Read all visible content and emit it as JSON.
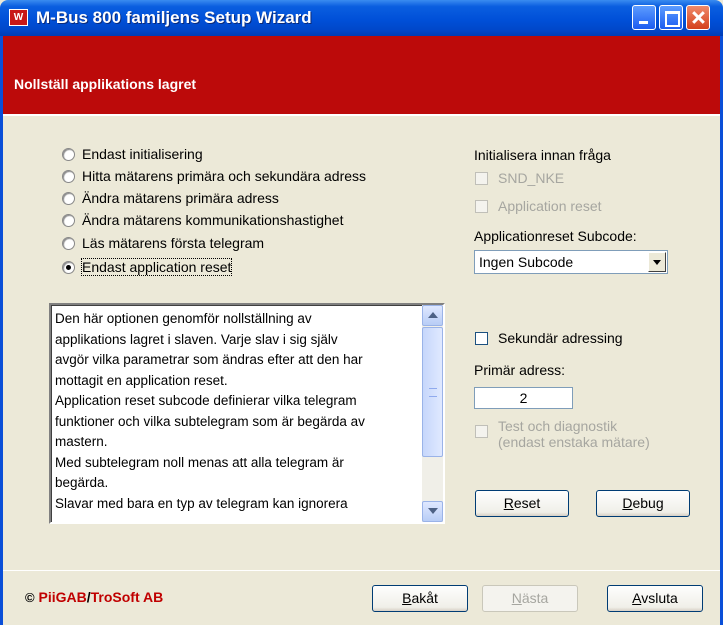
{
  "window": {
    "title": "M-Bus 800 familjens Setup Wizard",
    "app_icon_text": "W"
  },
  "header": {
    "title": "Nollställ applikations lagret"
  },
  "options": [
    {
      "label": "Endast initialisering",
      "checked": false
    },
    {
      "label": "Hitta mätarens primära och sekundära adress",
      "checked": false
    },
    {
      "label": "Ändra mätarens primära adress",
      "checked": false
    },
    {
      "label": "Ändra mätarens kommunikationshastighet",
      "checked": false
    },
    {
      "label": "Läs mätarens första telegram",
      "checked": false
    },
    {
      "label": "Endast application reset",
      "checked": true
    }
  ],
  "description": {
    "lines": [
      "Den här optionen genomför nollställning av",
      "applikations lagret i slaven. Varje slav i sig själv",
      "avgör vilka parametrar som ändras efter att den har",
      "mottagit en application reset.",
      "Application reset subcode definierar vilka telegram",
      "funktioner och vilka subtelegram som är begärda av",
      "mastern.",
      "Med subtelegram noll menas att alla telegram är",
      "begärda.",
      "Slavar med bara en typ av telegram kan ignorera"
    ]
  },
  "right_panel": {
    "init_heading": "Initialisera innan fråga",
    "snd_nke_label": "SND_NKE",
    "app_reset_label": "Application reset",
    "subcode_label": "Applicationreset Subcode:",
    "subcode_value": "Ingen Subcode",
    "secondary_label": "Sekundär adressing",
    "primary_label": "Primär adress:",
    "primary_value": "2",
    "test_label_line1": "Test och diagnostik",
    "test_label_line2": "(endast enstaka mätare)",
    "reset_button_prefix": "R",
    "reset_button_rest": "eset",
    "debug_button_prefix": "D",
    "debug_button_rest": "ebug"
  },
  "footer": {
    "copyright_symbol": "©",
    "brand1": "PiiGAB",
    "slash": "/",
    "brand2": "TroSoft AB",
    "back_prefix": "B",
    "back_rest": "akåt",
    "next_prefix": "N",
    "next_rest": "ästa",
    "exit_prefix": "A",
    "exit_rest": "vsluta"
  }
}
